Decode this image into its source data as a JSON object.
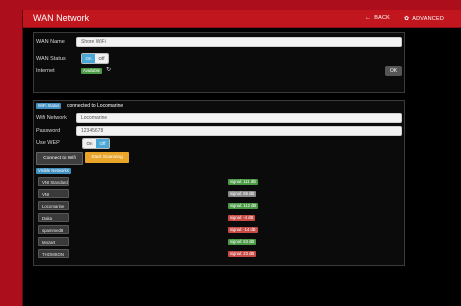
{
  "header": {
    "title": "WAN Network",
    "back_label": "BACK",
    "advanced_label": "ADVANCED"
  },
  "wan": {
    "name_label": "WAN Name",
    "name_value": "Shore WiFi",
    "status_label": "WAN Status",
    "status_on": "On",
    "status_off": "Off",
    "internet_label": "Internet",
    "internet_status": "Available",
    "ok_label": "OK"
  },
  "wifi": {
    "status_badge": "WiFi Status",
    "status_text": "connected to Locomarine",
    "network_label": "Wifi Network",
    "network_value": "Locomarine",
    "password_label": "Password",
    "password_value": "12345678",
    "wep_label": "Use WEP",
    "wep_on": "On",
    "wep_off": "Off",
    "connect_label": "Connect to Wifi",
    "scan_label": "Start Scanning",
    "visible_label": "Visible Networks",
    "networks": [
      {
        "name": "VNI Standard",
        "signal": "signal: 111 dB",
        "color": "#4c9a46"
      },
      {
        "name": "VNI",
        "signal": "signal: 66 dB",
        "color": "#8a8a8a"
      },
      {
        "name": "Locomarine",
        "signal": "signal: 112 dB",
        "color": "#4c9a46"
      },
      {
        "name": "Daka",
        "signal": "signal: -4 dB",
        "color": "#c84b46"
      },
      {
        "name": "spammed8",
        "signal": "signal: -14 dB",
        "color": "#c84b46"
      },
      {
        "name": "Mozart",
        "signal": "signal: 63 dB",
        "color": "#4c9a46"
      },
      {
        "name": "THOMSON",
        "signal": "signal: 23 dB",
        "color": "#c84b46"
      }
    ]
  }
}
